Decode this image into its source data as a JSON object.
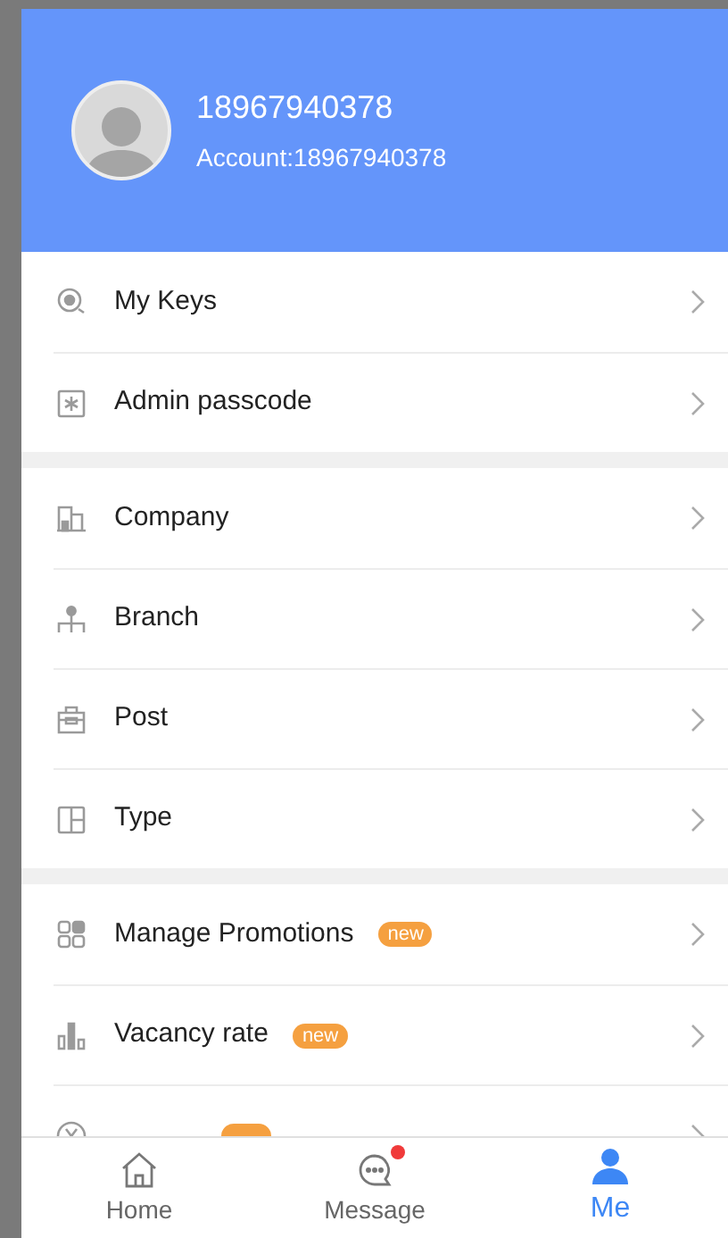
{
  "profile": {
    "name": "18967940378",
    "account": "Account:18967940378"
  },
  "sections": [
    {
      "items": [
        {
          "label": "My Keys"
        },
        {
          "label": "Admin passcode"
        }
      ]
    },
    {
      "items": [
        {
          "label": "Company"
        },
        {
          "label": "Branch"
        },
        {
          "label": "Post"
        },
        {
          "label": "Type"
        }
      ]
    },
    {
      "items": [
        {
          "label": "Manage Promotions",
          "badge": "new"
        },
        {
          "label": "Vacancy rate",
          "badge": "new"
        },
        {
          "covered": true
        }
      ]
    }
  ],
  "nav": [
    {
      "label": "Home",
      "selected": false,
      "unread": false
    },
    {
      "label": "Message",
      "selected": false,
      "unread": true
    },
    {
      "label": "Me",
      "selected": true,
      "unread": false
    }
  ]
}
